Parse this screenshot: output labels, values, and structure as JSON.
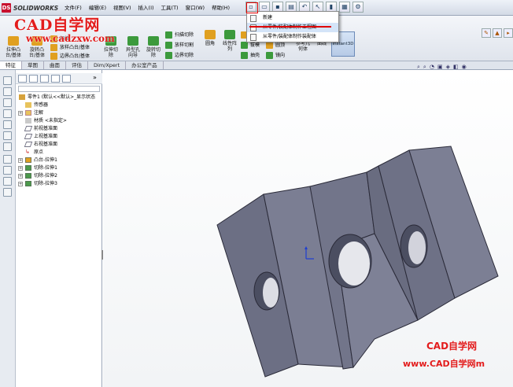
{
  "app": {
    "logo_text": "SOLIDWORKS",
    "logo_badge": "DS"
  },
  "menu": [
    "文件(F)",
    "编辑(E)",
    "视图(V)",
    "插入(I)",
    "工具(T)",
    "窗口(W)",
    "帮助(H)"
  ],
  "new_dropdown": {
    "items": [
      "新建",
      "从零件/装配体制作工程图",
      "从零件/装配体制作装配体"
    ],
    "highlighted_index": 1
  },
  "watermarks": {
    "top_title": "CAD自学网",
    "top_url": "www.cadzxw.com",
    "bottom_title": "CAD自学网",
    "bottom_url": "www.CAD自学网m"
  },
  "command_manager": {
    "large": [
      {
        "label": "拉伸凸\n台/基体",
        "color": "#e0a020"
      },
      {
        "label": "旋转凸\n台/基体",
        "color": "#e0a020"
      },
      {
        "label": "拉伸切\n除",
        "color": "#3c9a3c"
      },
      {
        "label": "异型孔\n向导",
        "color": "#3c9a3c"
      },
      {
        "label": "旋转切\n除",
        "color": "#3c9a3c"
      },
      {
        "label": "圆角",
        "color": "#e0a020"
      },
      {
        "label": "线性阵\n列",
        "color": "#3c9a3c"
      },
      {
        "label": "参考几\n何体",
        "color": "#7a7acc"
      },
      {
        "label": "曲线",
        "color": "#7a7acc"
      }
    ],
    "small": [
      "扫描",
      "放样凸台/基体",
      "边界凸台/基体",
      "扫描切除",
      "放样切割",
      "边界切除",
      "筋",
      "拔模",
      "抽壳",
      "包覆",
      "圆顶",
      "镜向"
    ],
    "instant3d": "Instant3D"
  },
  "tabs": [
    "特征",
    "草图",
    "曲面",
    "评估",
    "Dim/Xpert",
    "办公室产品"
  ],
  "active_tab": 0,
  "tree": {
    "root": "零件1 (默认<<默认>_显示状态",
    "items": [
      {
        "label": "传感器",
        "icon": "sensor-icon"
      },
      {
        "label": "注解",
        "icon": "annotation-icon"
      },
      {
        "label": "材质 <未指定>",
        "icon": "material-icon"
      },
      {
        "label": "前视基准面",
        "icon": "plane-icon"
      },
      {
        "label": "上视基准面",
        "icon": "plane-icon"
      },
      {
        "label": "右视基准面",
        "icon": "plane-icon"
      },
      {
        "label": "原点",
        "icon": "origin-icon"
      },
      {
        "label": "凸台-拉伸1",
        "icon": "boss-extrude-icon"
      },
      {
        "label": "切除-拉伸1",
        "icon": "cut-extrude-icon"
      },
      {
        "label": "切除-拉伸2",
        "icon": "cut-extrude-icon"
      },
      {
        "label": "切除-拉伸3",
        "icon": "cut-extrude-icon"
      }
    ]
  },
  "colors": {
    "part_face": "#7a7d92",
    "part_face_light": "#8b8ea3",
    "part_edge": "#2a2a38",
    "hole": "#4e5164",
    "accent_red": "#e31c1c"
  }
}
